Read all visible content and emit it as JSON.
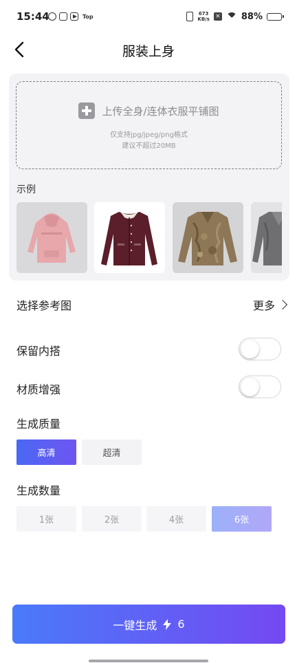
{
  "status_bar": {
    "time": "15:44",
    "top_label": "Top",
    "net_speed_value": "673",
    "net_speed_unit": "KB/s",
    "battery_pct": "88%",
    "battery_level": 0.88
  },
  "header": {
    "title": "服装上身"
  },
  "upload": {
    "label": "上传全身/连体衣服平铺图",
    "hint_formats": "仅支持jpg/jpeg/png格式",
    "hint_size": "建议不超过20MB"
  },
  "examples": {
    "label": "示例",
    "items": [
      {
        "name": "pink-hoodie",
        "color": "#e7a7ab"
      },
      {
        "name": "maroon-cardigan",
        "color": "#5a1f2a"
      },
      {
        "name": "fur-jacket",
        "color": "#8d7757"
      },
      {
        "name": "gray-coat",
        "color": "#6f6f72"
      }
    ]
  },
  "reference": {
    "label": "选择参考图",
    "more_label": "更多"
  },
  "options": {
    "keep_inner": {
      "label": "保留内搭",
      "on": false
    },
    "material_enhance": {
      "label": "材质增强",
      "on": false
    }
  },
  "quality": {
    "label": "生成质量",
    "options": [
      "高清",
      "超清"
    ],
    "selected": "高清"
  },
  "count": {
    "label": "生成数量",
    "options": [
      "1张",
      "2张",
      "4张",
      "6张"
    ],
    "selected": "6张"
  },
  "generate": {
    "label": "一键生成",
    "cost": "6"
  },
  "colors": {
    "accent_start": "#4a7af9",
    "accent_end": "#7449f2",
    "card_bg": "#f3f3f6"
  }
}
